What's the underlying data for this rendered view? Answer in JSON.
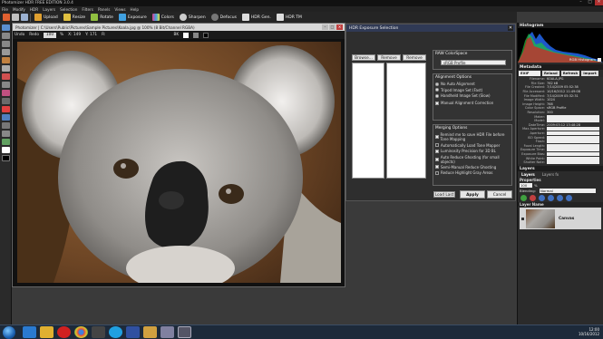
{
  "app": {
    "title": "Photomizer HDR FREE EDITION 3.0.4",
    "window_controls": [
      "–",
      "□",
      "✕"
    ]
  },
  "menu": [
    "File",
    "Modify",
    "HDR",
    "Layers",
    "Selection",
    "Filters",
    "Panels",
    "Views",
    "Help"
  ],
  "toolbar": {
    "buttons": [
      {
        "label": "Upload",
        "icon": "upload-icon",
        "color": "#e0a030"
      },
      {
        "label": "Resize",
        "icon": "resize-icon",
        "color": "#e0c040"
      },
      {
        "label": "Rotate",
        "icon": "rotate-icon",
        "color": "#90c040"
      },
      {
        "label": "Exposure",
        "icon": "exposure-icon",
        "color": "#40a0e0"
      },
      {
        "label": "Colors",
        "icon": "colors-icon",
        "color": "#e04090"
      },
      {
        "label": "Sharpen",
        "icon": "sharpen-icon",
        "color": "#cccccc"
      },
      {
        "label": "Defocus",
        "icon": "defocus-icon",
        "color": "#888888"
      },
      {
        "label": "HDR Gen.",
        "icon": "hdr-gen-icon",
        "color": "#ffffff"
      },
      {
        "label": "HDR TM",
        "icon": "hdr-tm-icon",
        "color": "#ffffff"
      }
    ]
  },
  "image_window": {
    "title": "Photomizer | C:\\Users\\Public\\Pictures\\Sample Pictures\\Koala.jpg @ 100% (8 Bit/Channel RGBA)",
    "options": {
      "undo": "Undo",
      "redo": "Redo",
      "zoom": "100",
      "zoom_unit": "%",
      "coord_x": "X: 149",
      "coord_y": "Y: 171",
      "rc": "R:",
      "bk": "BK"
    }
  },
  "hdr_dialog": {
    "title": "HDR Exposure Selection",
    "browse": "Browse...",
    "remove": "Remove",
    "remove_all": "Remove All",
    "colorspace": {
      "header": "RAW ColorSpace",
      "value": "sRGB Profile"
    },
    "alignment": {
      "header": "Alignment Options",
      "options": [
        "No Auto Alignment",
        "Tripod Image Set (Fast)",
        "Handheld Image Set (Slow)"
      ],
      "checkbox": "Manual Alignment Correction"
    },
    "merging": {
      "header": "Merging Options",
      "options": [
        "Remind me to save HDR File before Tone Mapping",
        "Automatically Load Tone Mapper",
        "Luminosity Precision for 3D BL",
        "Auto Reduce Ghosting (for small objects)",
        "Semi-Manual Reduce Ghosting",
        "Reduce Highlight Gray Areas"
      ]
    },
    "load_last": "Load Last",
    "apply": "Apply",
    "cancel": "Cancel"
  },
  "histogram": {
    "header": "Histogram",
    "mode": "RGB Histogram"
  },
  "metadata": {
    "header": "Metadata",
    "format": "EXIF",
    "buttons": [
      "Reload",
      "Refresh",
      "Import"
    ],
    "rows": [
      {
        "k": "Filename:",
        "v": "KOALA.JPG"
      },
      {
        "k": "File Size:",
        "v": "762 kB"
      },
      {
        "k": "File Created:",
        "v": "7/14/2009 05:52:38"
      },
      {
        "k": "File Accessed:",
        "v": "10/16/2012 11:49:08"
      },
      {
        "k": "File Modified:",
        "v": "7/14/2009 05:32:31"
      },
      {
        "k": "Image Width:",
        "v": "1024"
      },
      {
        "k": "Image Height:",
        "v": "768"
      },
      {
        "k": "Color Space:",
        "v": "sRGB Profile"
      },
      {
        "k": "Resolution:",
        "v": "300"
      },
      {
        "k": "Maker:",
        "v": ""
      },
      {
        "k": "Model:",
        "v": ""
      },
      {
        "k": "DateTime:",
        "v": "2009:03:12 13:48:28"
      },
      {
        "k": "Max Aperture:",
        "v": ""
      },
      {
        "k": "Aperture:",
        "v": ""
      },
      {
        "k": "ISO Speed:",
        "v": ""
      },
      {
        "k": "Flash:",
        "v": ""
      },
      {
        "k": "Focal Length:",
        "v": ""
      },
      {
        "k": "Exposure Time:",
        "v": ""
      },
      {
        "k": "Exposure Bias:",
        "v": ""
      },
      {
        "k": "White Point:",
        "v": ""
      },
      {
        "k": "Shutter Note:",
        "v": ""
      }
    ]
  },
  "layers": {
    "header": "Layers",
    "tabs": [
      "Layers",
      "Layers fx"
    ],
    "properties": "Properties",
    "opacity": "100",
    "opacity_unit": "%",
    "blending_label": "Blending:",
    "blending": "Normal",
    "col_header": "Layer Name",
    "layer_name": "Canvas"
  },
  "taskbar": {
    "time": "12:00",
    "date": "10/16/2012",
    "apps": [
      "ie",
      "explorer",
      "opera",
      "chrome",
      "steam",
      "skype",
      "vpn",
      "folder",
      "photo",
      "photomizer"
    ]
  }
}
